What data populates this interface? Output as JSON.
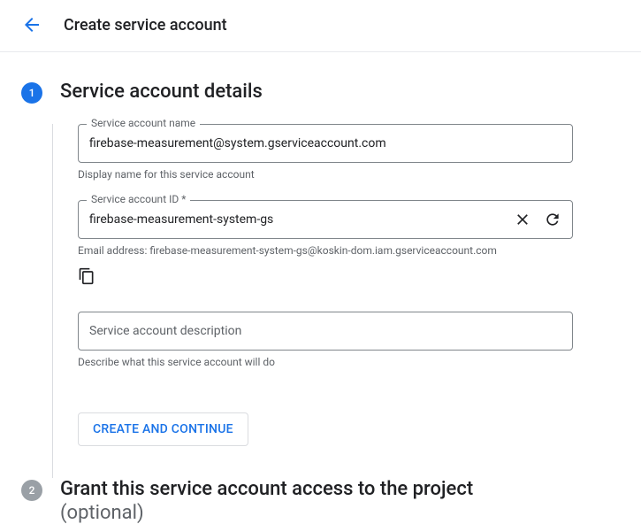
{
  "header": {
    "title": "Create service account"
  },
  "step1": {
    "number": "1",
    "title": "Service account details",
    "name_field": {
      "label": "Service account name",
      "value": "firebase-measurement@system.gserviceaccount.com",
      "helper": "Display name for this service account"
    },
    "id_field": {
      "label": "Service account ID *",
      "value": "firebase-measurement-system-gs",
      "helper": "Email address: firebase-measurement-system-gs@koskin-dom.iam.gserviceaccount.com"
    },
    "desc_field": {
      "placeholder": "Service account description",
      "helper": "Describe what this service account will do"
    },
    "create_button": "CREATE AND CONTINUE"
  },
  "step2": {
    "number": "2",
    "title": "Grant this service account access to the project",
    "optional": "(optional)"
  }
}
